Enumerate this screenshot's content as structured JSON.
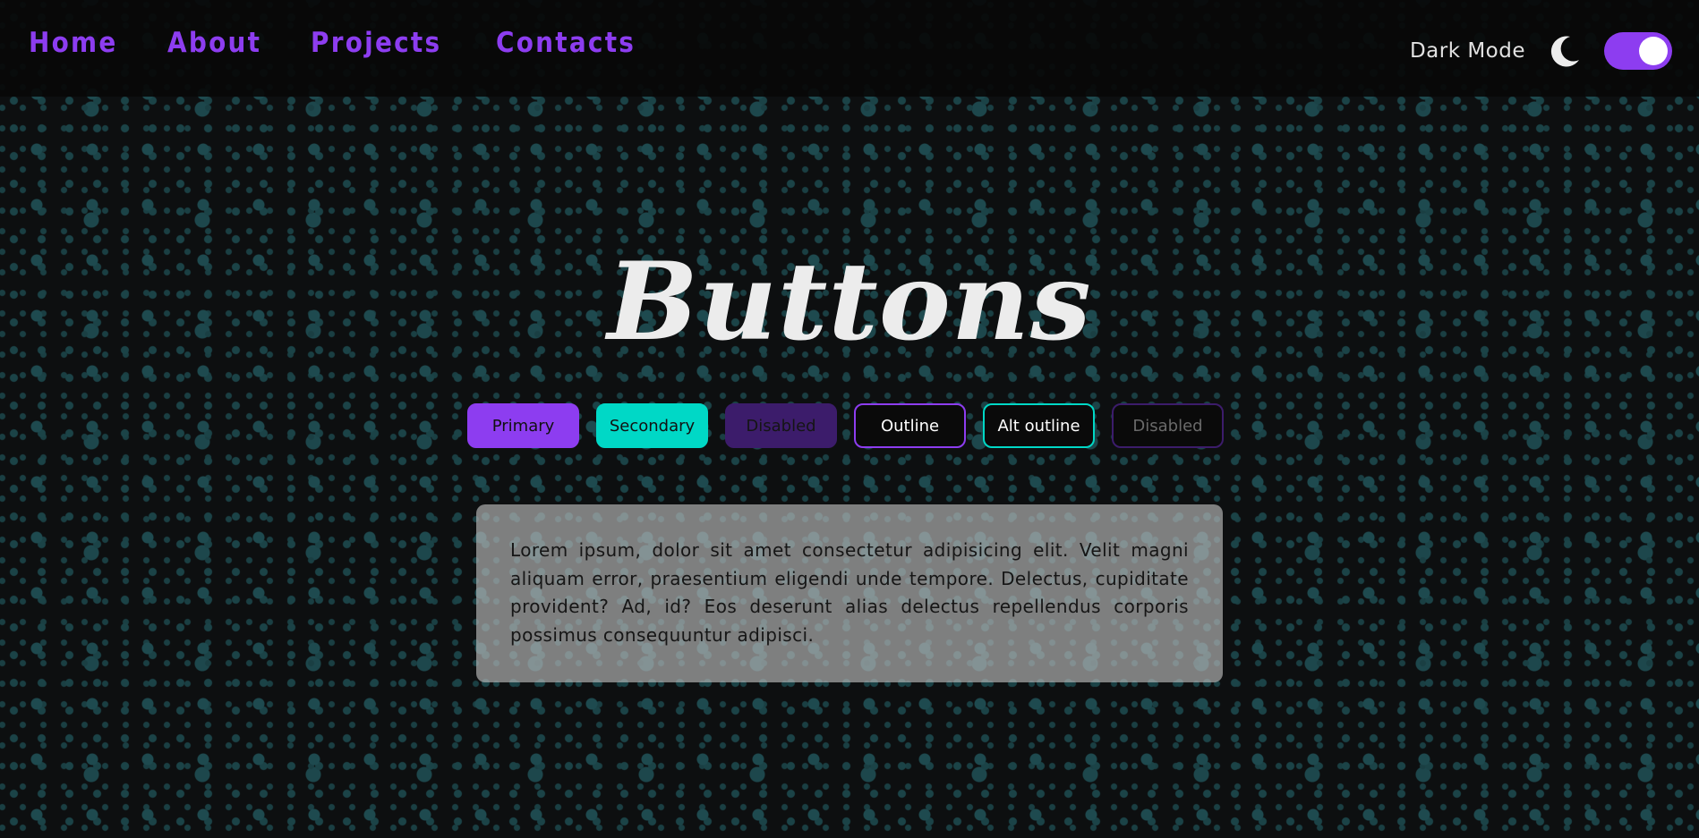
{
  "nav": {
    "links": [
      {
        "label": "Home"
      },
      {
        "label": "About"
      },
      {
        "label": "Projects"
      },
      {
        "label": "Contacts"
      }
    ]
  },
  "mode": {
    "label": "Dark Mode",
    "icon": "moon-icon",
    "toggle_on": true
  },
  "page": {
    "title": "Buttons"
  },
  "buttons": {
    "primary": "Primary",
    "secondary": "Secondary",
    "disabled": "Disabled",
    "outline": "Outline",
    "alt_outline": "Alt outline",
    "disabled_outline": "Disabled"
  },
  "card": {
    "text": "Lorem ipsum, dolor sit amet consectetur adipisicing elit. Velit magni aliquam error, praesentium eligendi unde tempore. Delectus, cupiditate provident? Ad, id? Eos deserunt alias delectus repellendus corporis possimus consequuntur adipisci."
  },
  "colors": {
    "accent_purple": "#8d3df0",
    "accent_teal": "#00d8c6",
    "disabled_purple": "#3c1c6b",
    "background": "#0d0f10",
    "dot_color": "#1e4a4f"
  }
}
